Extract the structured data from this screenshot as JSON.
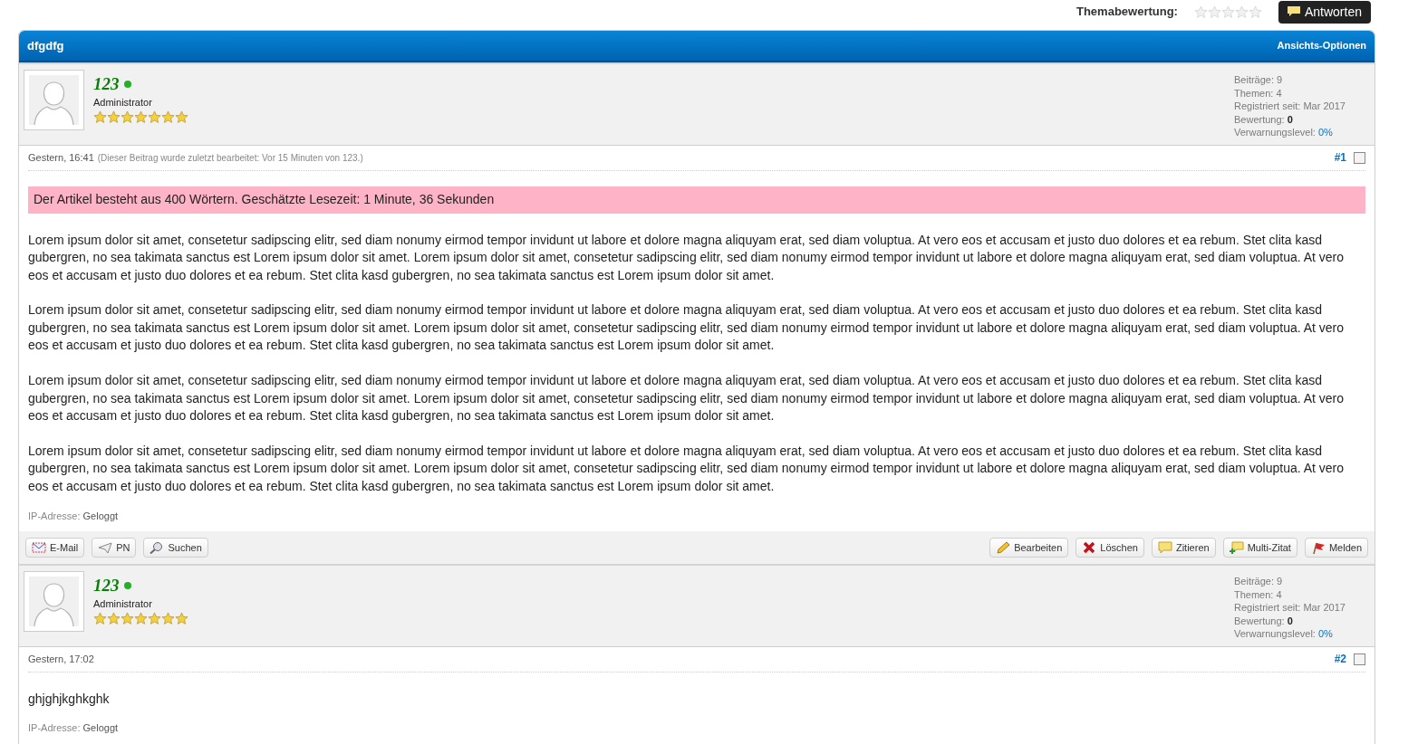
{
  "top_bar": {
    "rating_label": "Themabewertung:",
    "rating": {
      "stars": 0
    },
    "reply_button": "Antworten"
  },
  "thread": {
    "title": "dfgdfg",
    "options_link": "Ansichts-Optionen",
    "posts": [
      {
        "author": {
          "name": "123",
          "online": true,
          "rank": "Administrator",
          "stars": 7
        },
        "stats": [
          {
            "label": "Beiträge:",
            "value": "9",
            "kind": "plain"
          },
          {
            "label": "Themen:",
            "value": "4",
            "kind": "plain"
          },
          {
            "label": "Registriert seit:",
            "value": "Mar 2017",
            "kind": "plain"
          },
          {
            "label": "Bewertung:",
            "value": "0",
            "kind": "bold"
          },
          {
            "label": "Verwarnungslevel:",
            "value": "0%",
            "kind": "link"
          }
        ],
        "date": "Gestern, 16:41",
        "edit_note": "(Dieser Beitrag wurde zuletzt bearbeitet: Vor 15 Minuten von 123.)",
        "number": "#1",
        "selected": false,
        "banner": "Der Artikel besteht aus 400 Wörtern. Geschätzte Lesezeit: 1 Minute, 36 Sekunden",
        "paragraphs": [
          "Lorem ipsum dolor sit amet, consetetur sadipscing elitr, sed diam nonumy eirmod tempor invidunt ut labore et dolore magna aliquyam erat, sed diam voluptua. At vero eos et accusam et justo duo dolores et ea rebum. Stet clita kasd gubergren, no sea takimata sanctus est Lorem ipsum dolor sit amet. Lorem ipsum dolor sit amet, consetetur sadipscing elitr, sed diam nonumy eirmod tempor invidunt ut labore et dolore magna aliquyam erat, sed diam voluptua. At vero eos et accusam et justo duo dolores et ea rebum. Stet clita kasd gubergren, no sea takimata sanctus est Lorem ipsum dolor sit amet.",
          "Lorem ipsum dolor sit amet, consetetur sadipscing elitr, sed diam nonumy eirmod tempor invidunt ut labore et dolore magna aliquyam erat, sed diam voluptua. At vero eos et accusam et justo duo dolores et ea rebum. Stet clita kasd gubergren, no sea takimata sanctus est Lorem ipsum dolor sit amet. Lorem ipsum dolor sit amet, consetetur sadipscing elitr, sed diam nonumy eirmod tempor invidunt ut labore et dolore magna aliquyam erat, sed diam voluptua. At vero eos et accusam et justo duo dolores et ea rebum. Stet clita kasd gubergren, no sea takimata sanctus est Lorem ipsum dolor sit amet.",
          "Lorem ipsum dolor sit amet, consetetur sadipscing elitr, sed diam nonumy eirmod tempor invidunt ut labore et dolore magna aliquyam erat, sed diam voluptua. At vero eos et accusam et justo duo dolores et ea rebum. Stet clita kasd gubergren, no sea takimata sanctus est Lorem ipsum dolor sit amet. Lorem ipsum dolor sit amet, consetetur sadipscing elitr, sed diam nonumy eirmod tempor invidunt ut labore et dolore magna aliquyam erat, sed diam voluptua. At vero eos et accusam et justo duo dolores et ea rebum. Stet clita kasd gubergren, no sea takimata sanctus est Lorem ipsum dolor sit amet.",
          "Lorem ipsum dolor sit amet, consetetur sadipscing elitr, sed diam nonumy eirmod tempor invidunt ut labore et dolore magna aliquyam erat, sed diam voluptua. At vero eos et accusam et justo duo dolores et ea rebum. Stet clita kasd gubergren, no sea takimata sanctus est Lorem ipsum dolor sit amet. Lorem ipsum dolor sit amet, consetetur sadipscing elitr, sed diam nonumy eirmod tempor invidunt ut labore et dolore magna aliquyam erat, sed diam voluptua. At vero eos et accusam et justo duo dolores et ea rebum. Stet clita kasd gubergren, no sea takimata sanctus est Lorem ipsum dolor sit amet."
        ],
        "ip_label": "IP-Adresse:",
        "ip_value": "Geloggt",
        "buttons_left": [
          {
            "label": "E-Mail",
            "kind": "mail"
          },
          {
            "label": "PN",
            "kind": "plane"
          },
          {
            "label": "Suchen",
            "kind": "search"
          }
        ],
        "buttons_right": [
          {
            "label": "Bearbeiten",
            "kind": "pencil"
          },
          {
            "label": "Löschen",
            "kind": "delete"
          },
          {
            "label": "Zitieren",
            "kind": "quote"
          },
          {
            "label": "Multi-Zitat",
            "kind": "multiquote"
          },
          {
            "label": "Melden",
            "kind": "flag"
          }
        ]
      },
      {
        "author": {
          "name": "123",
          "online": true,
          "rank": "Administrator",
          "stars": 7
        },
        "stats": [
          {
            "label": "Beiträge:",
            "value": "9",
            "kind": "plain"
          },
          {
            "label": "Themen:",
            "value": "4",
            "kind": "plain"
          },
          {
            "label": "Registriert seit:",
            "value": "Mar 2017",
            "kind": "plain"
          },
          {
            "label": "Bewertung:",
            "value": "0",
            "kind": "bold"
          },
          {
            "label": "Verwarnungslevel:",
            "value": "0%",
            "kind": "link"
          }
        ],
        "date": "Gestern, 17:02",
        "number": "#2",
        "selected": false,
        "paragraphs": [
          "ghjghjkghkghk"
        ],
        "ip_label": "IP-Adresse:",
        "ip_value": "Geloggt"
      }
    ]
  }
}
